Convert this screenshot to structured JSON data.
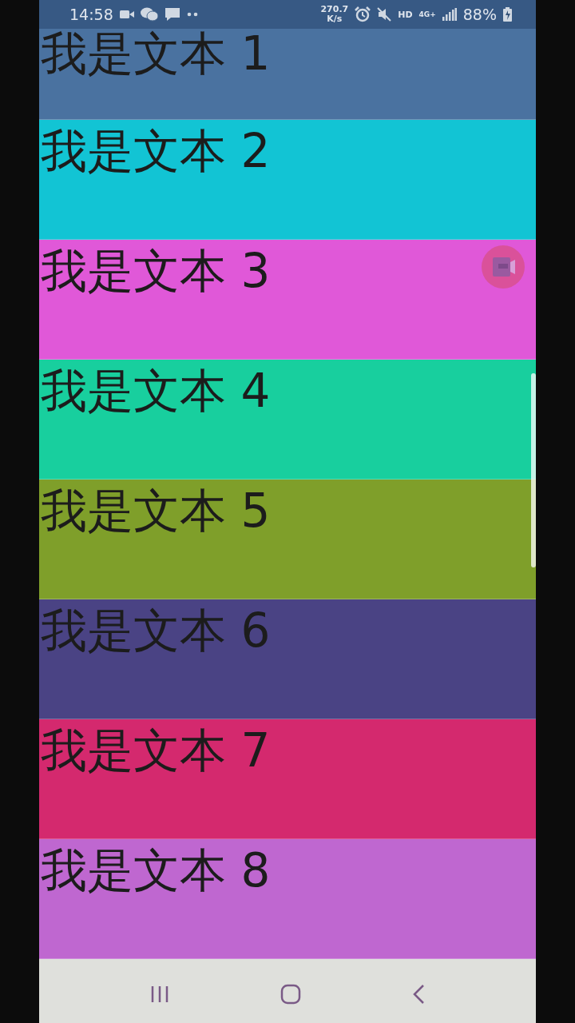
{
  "status_bar": {
    "time": "14:58",
    "speed_value": "270.7",
    "speed_unit": "K/s",
    "hd": "HD",
    "network": "4G+",
    "battery": "88%"
  },
  "list": [
    {
      "text": "我是文本 1",
      "color": "#4a72a0"
    },
    {
      "text": "我是文本 2",
      "color": "#12c4d4"
    },
    {
      "text": "我是文本 3",
      "color": "#e058d8"
    },
    {
      "text": "我是文本 4",
      "color": "#18cf9e"
    },
    {
      "text": "我是文本 5",
      "color": "#7f9f2a"
    },
    {
      "text": "我是文本 6",
      "color": "#4a4384"
    },
    {
      "text": "我是文本 7",
      "color": "#d4296e"
    },
    {
      "text": "我是文本 8",
      "color": "#bf67d0"
    }
  ]
}
